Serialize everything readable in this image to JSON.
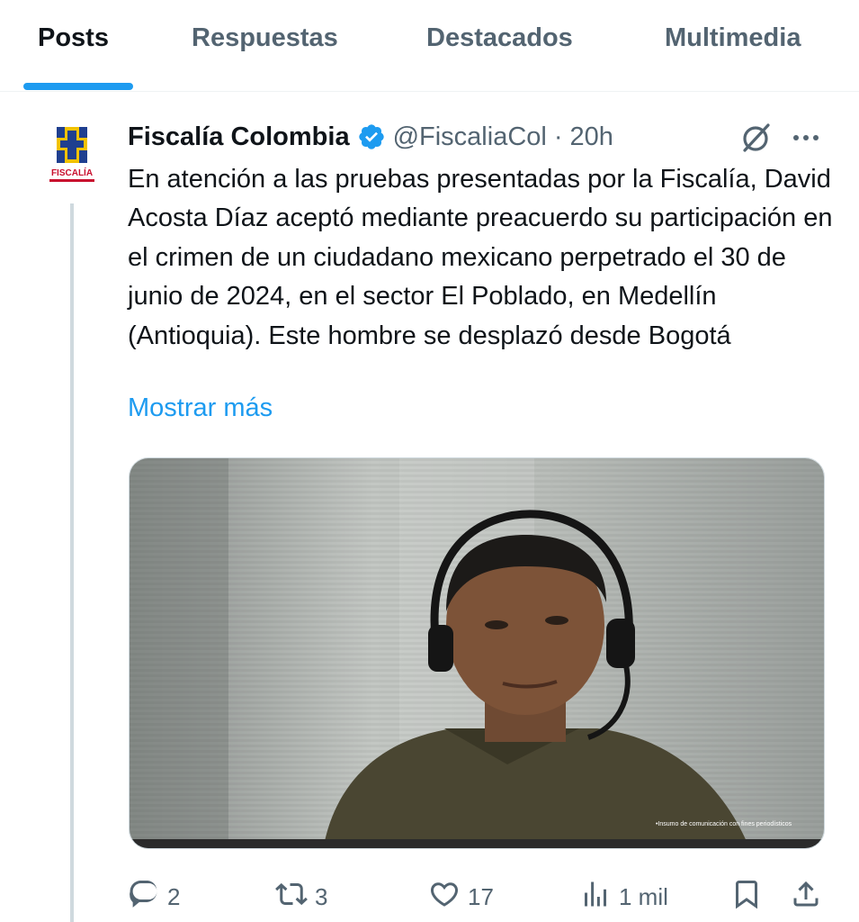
{
  "tabs": [
    {
      "label": "Posts",
      "active": true
    },
    {
      "label": "Respuestas",
      "active": false
    },
    {
      "label": "Destacados",
      "active": false
    },
    {
      "label": "Multimedia",
      "active": false
    }
  ],
  "tweet": {
    "author_name": "Fiscalía Colombia",
    "handle": "@FiscaliaCol",
    "separator": "·",
    "time": "20h",
    "avatar_text": "FISCALÍA",
    "text": "En atención a las pruebas presentadas por la Fiscalía, David Acosta Díaz aceptó mediante preacuerdo su participación en el crimen de un ciudadano mexicano perpetrado el 30 de junio de 2024, en el sector El Poblado, en Medellín (Antioquia). Este hombre se desplazó desde Bogotá",
    "show_more": "Mostrar más",
    "media_caption": "•Insumo de comunicación con fines periodísticos",
    "stats": {
      "replies": "2",
      "reposts": "3",
      "likes": "17",
      "views": "1 mil"
    }
  },
  "colors": {
    "accent": "#1d9bf0",
    "text_primary": "#0f1419",
    "text_secondary": "#536471",
    "divider": "#eff3f4"
  },
  "icons": [
    "verified-badge-icon",
    "grok-icon",
    "more-icon",
    "reply-icon",
    "repost-icon",
    "like-icon",
    "views-icon",
    "bookmark-icon",
    "share-icon"
  ]
}
